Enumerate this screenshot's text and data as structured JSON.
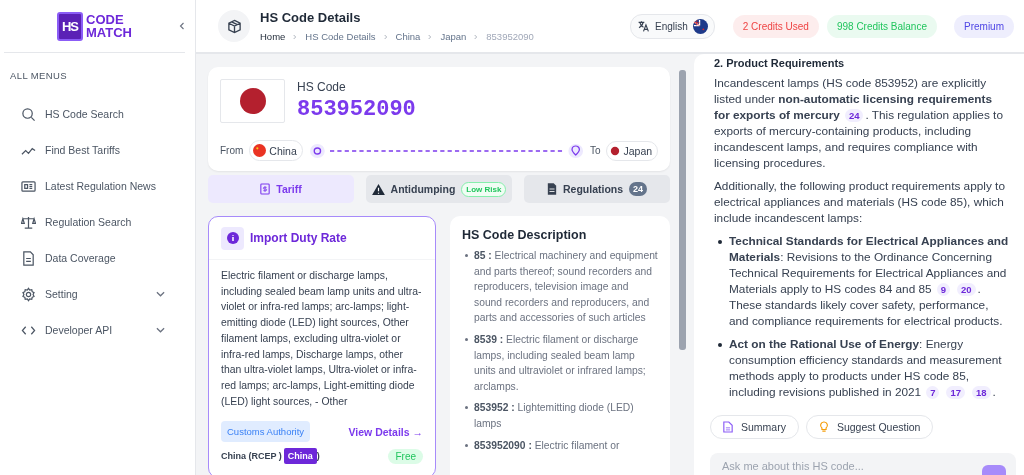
{
  "sidebar": {
    "logo": {
      "mark": "HS",
      "line1": "CODE",
      "line2": "MATCH"
    },
    "section_title": "ALL MENUS",
    "items": [
      {
        "label": "HS Code Search",
        "has_submenu": false
      },
      {
        "label": "Find Best Tariffs",
        "has_submenu": false
      },
      {
        "label": "Latest Regulation News",
        "has_submenu": false
      },
      {
        "label": "Regulation Search",
        "has_submenu": false
      },
      {
        "label": "Data Coverage",
        "has_submenu": false
      },
      {
        "label": "Setting",
        "has_submenu": true
      },
      {
        "label": "Developer API",
        "has_submenu": true
      }
    ]
  },
  "header": {
    "title": "HS Code Details",
    "breadcrumbs": [
      {
        "label": "Home",
        "current": false
      },
      {
        "label": "HS Code Details",
        "current": false
      },
      {
        "label": "China",
        "current": false
      },
      {
        "label": "Japan",
        "current": false
      },
      {
        "label": "853952090",
        "current": true
      }
    ],
    "language": "English",
    "chips": [
      {
        "text": "2 Credits Used",
        "color": "#ef4444"
      },
      {
        "text": "998 Credits Balance",
        "color": "#22c55e"
      },
      {
        "text": "Premium",
        "color": "#4f46e5"
      }
    ]
  },
  "hs_card": {
    "label": "HS Code",
    "code": "853952090",
    "from_label": "From",
    "from": "China",
    "to_label": "To",
    "to": "Japan"
  },
  "tabs": [
    {
      "label": "Tariff",
      "selected": true
    },
    {
      "label": "Antidumping",
      "selected": false,
      "badge": "Low Risk"
    },
    {
      "label": "Regulations",
      "selected": false,
      "count": "24"
    }
  ],
  "duty_card": {
    "title": "Import Duty Rate",
    "text": "Electric filament or discharge lamps, including sealed beam lamp units and ultra-violet or infra-red lamps; arc-lamps; light-emitting diode (LED) light sources, Other filament lamps, excluding ultra-violet or infra-red lamps, Discharge lamps, other than ultra-violet lamps, Ultra-violet or infra-red lamps; arc-lamps, Light-emitting diode (LED) light sources, - Other",
    "authority": "Customs Authority",
    "link": "View Details →",
    "rate_label": "China (RCEP )",
    "rate_tag": "China",
    "rate_close": ")",
    "rate": "Free"
  },
  "description": {
    "title": "HS Code Description",
    "items": [
      {
        "code": "85 :",
        "text": "Electrical machinery and equipment and parts thereof; sound recorders and reproducers, television image and sound recorders and reproducers, and parts and accessories of such articles"
      },
      {
        "code": "8539 :",
        "text": "Electric filament or discharge lamps, including sealed beam lamp units and ultraviolet or infrared lamps; arclamps."
      },
      {
        "code": "853952 :",
        "text": "Lightemitting diode (LED) lamps"
      },
      {
        "code": "853952090 :",
        "text": "Electric filament or"
      }
    ]
  },
  "chat": {
    "blocks": [
      {
        "kind": "heading",
        "text": "2. Product Requirements"
      },
      {
        "kind": "paragraph",
        "parts": [
          {
            "text": "Incandescent lamps (HS code 853952) are explicitly listed under **non-automatic licensing requirements for exports of mercury**"
          },
          {
            "cite": "24"
          },
          {
            "text": ". This regulation applies to exports of mercury-containing products, including incandescent lamps, and requires compliance with licensing procedures."
          }
        ]
      },
      {
        "kind": "paragraph",
        "parts": [
          {
            "text": "Additionally, the following product requirements apply to electrical appliances and materials (HS code 85), which include incandescent lamps:"
          }
        ]
      },
      {
        "kind": "bullets",
        "items": [
          {
            "parts": [
              {
                "text": "**Technical Standards for Electrical Appliances and Materials**: Revisions to the Ordinance Concerning Technical Requirements for Electrical Appliances and Materials apply to HS codes 84 and 85"
              },
              {
                "cite": "9"
              },
              {
                "cite": "20"
              },
              {
                "text": ". These standards likely cover safety, performance, and compliance requirements for electrical products."
              }
            ]
          },
          {
            "parts": [
              {
                "text": "**Act on the Rational Use of Energy**: Energy consumption efficiency standards and measurement methods apply to products under HS code 85, including revisions published in 2021"
              },
              {
                "cite": "7"
              },
              {
                "cite": "17"
              },
              {
                "cite": "18"
              },
              {
                "text": "."
              }
            ]
          }
        ]
      }
    ],
    "actions": [
      "Summary",
      "Suggest Question"
    ],
    "input": {
      "placeholder": "Ask me about this HS code..."
    }
  }
}
